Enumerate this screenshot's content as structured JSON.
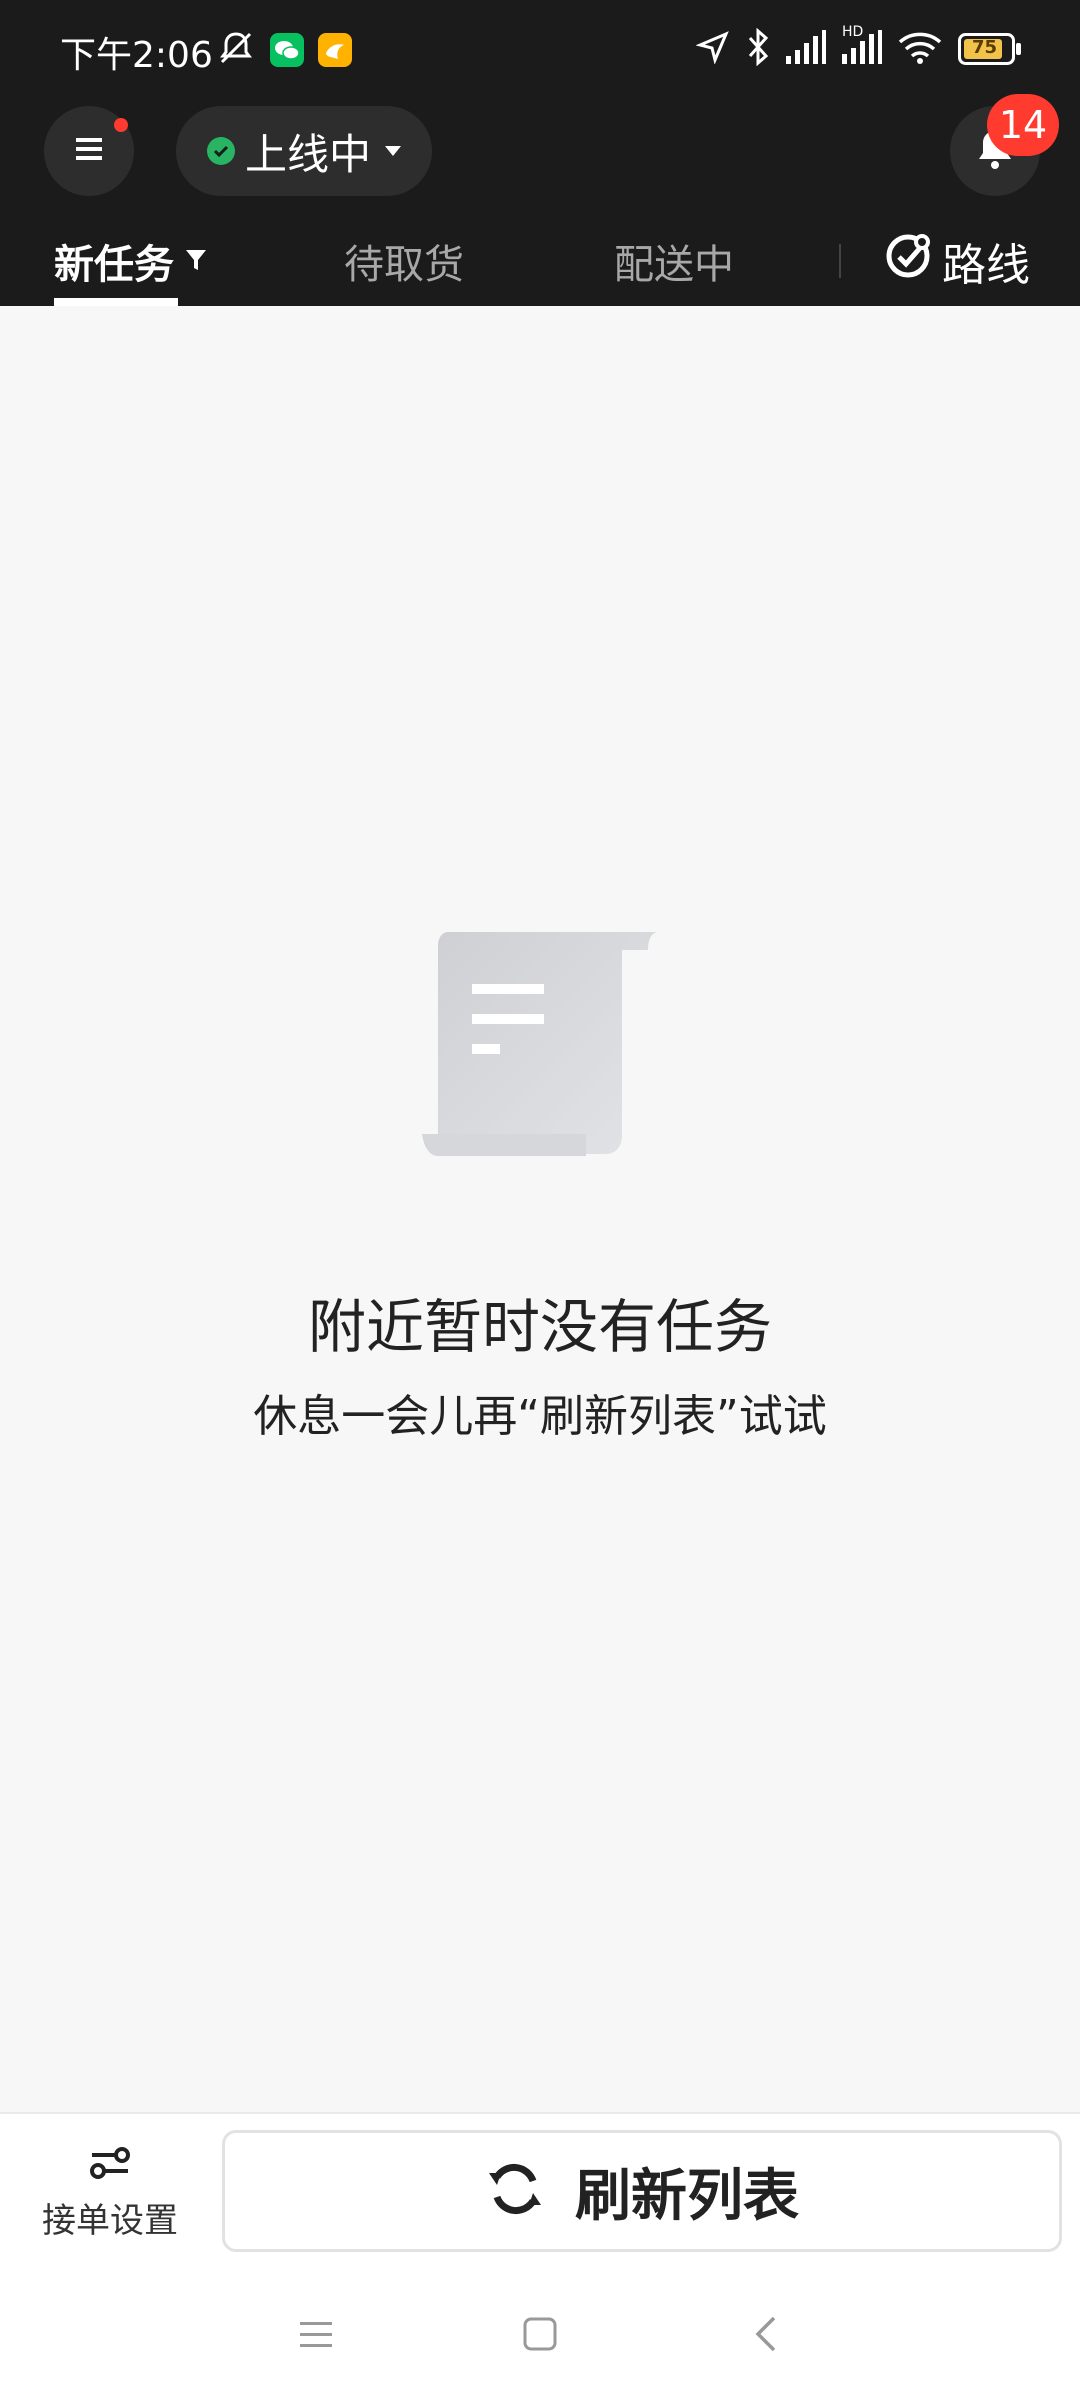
{
  "status_bar": {
    "time": "下午2:06",
    "battery": "75",
    "network_label": "HD"
  },
  "header": {
    "online_status": "上线中",
    "notification_count": "14"
  },
  "tabs": [
    {
      "label": "新任务",
      "active": true
    },
    {
      "label": "待取货",
      "active": false
    },
    {
      "label": "配送中",
      "active": false
    }
  ],
  "route": {
    "label": "路线"
  },
  "empty_state": {
    "title": "附近暂时没有任务",
    "subtitle": "休息一会儿再“刷新列表”试试"
  },
  "bottom": {
    "settings_label": "接单设置",
    "refresh_label": "刷新列表"
  },
  "colors": {
    "header_bg": "#1b1b1b",
    "online_green": "#28b463",
    "badge_red": "#ff3b30"
  },
  "icons": {
    "menu": "menu-icon",
    "bell": "bell-icon",
    "filter": "filter-icon",
    "route": "route-icon",
    "empty": "document-scroll-icon",
    "settings": "settings-slider-icon",
    "refresh": "refresh-icon"
  }
}
